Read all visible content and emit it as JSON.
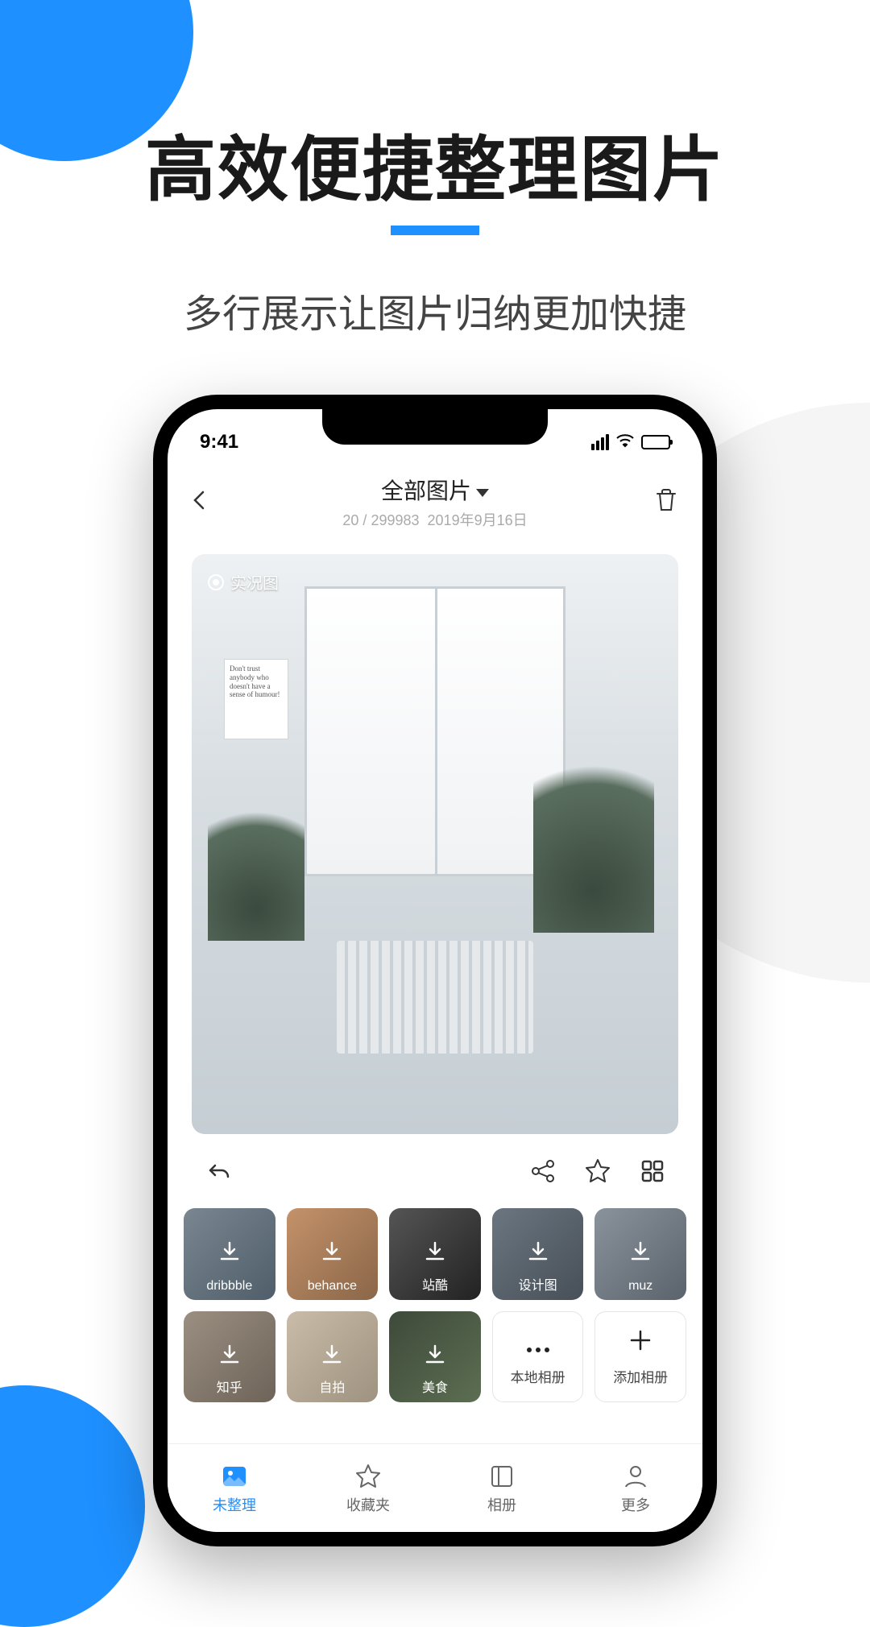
{
  "hero": {
    "title": "高效便捷整理图片",
    "subtitle": "多行展示让图片归纳更加快捷"
  },
  "statusbar": {
    "time": "9:41"
  },
  "nav": {
    "title": "全部图片",
    "count_current": "20",
    "count_sep": " / ",
    "count_total": "299983",
    "date": "2019年9月16日"
  },
  "image": {
    "live_badge": "实况图",
    "poster_text": "Don't trust anybody who doesn't have a sense of humour!"
  },
  "albums": [
    {
      "label": "dribbble",
      "type": "remote",
      "bg": "bg1"
    },
    {
      "label": "behance",
      "type": "remote",
      "bg": "bg2"
    },
    {
      "label": "站酷",
      "type": "remote",
      "bg": "bg3"
    },
    {
      "label": "设计图",
      "type": "remote",
      "bg": "bg4"
    },
    {
      "label": "muz",
      "type": "remote",
      "bg": "bg5"
    },
    {
      "label": "知乎",
      "type": "remote",
      "bg": "bg6"
    },
    {
      "label": "自拍",
      "type": "remote",
      "bg": "bg7"
    },
    {
      "label": "美食",
      "type": "remote",
      "bg": "bg8"
    },
    {
      "label": "本地相册",
      "type": "local",
      "icon": "dots"
    },
    {
      "label": "添加相册",
      "type": "local",
      "icon": "plus"
    }
  ],
  "tabs": [
    {
      "label": "未整理",
      "icon": "image",
      "active": true
    },
    {
      "label": "收藏夹",
      "icon": "star",
      "active": false
    },
    {
      "label": "相册",
      "icon": "album",
      "active": false
    },
    {
      "label": "更多",
      "icon": "profile",
      "active": false
    }
  ]
}
